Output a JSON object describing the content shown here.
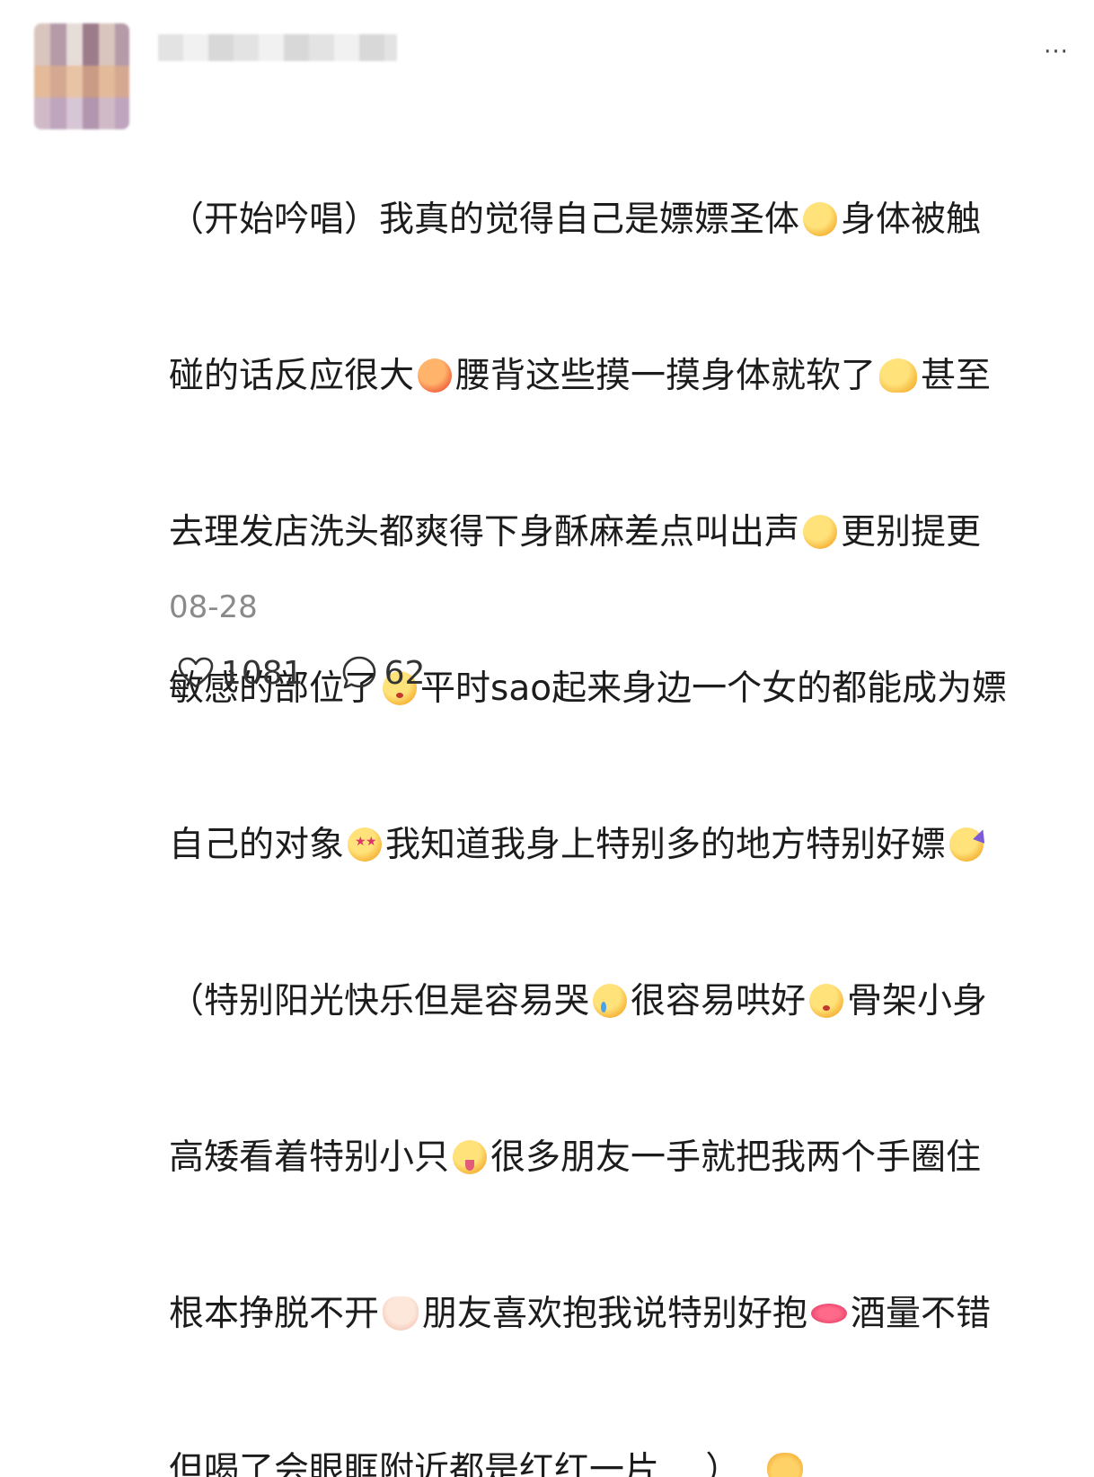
{
  "post": {
    "lines": [
      "（开始吟唱）我真的觉得自己是嫖嫖圣体",
      "身体被触",
      "碰的话反应很大",
      "腰背这些摸一摸身体就软了",
      "甚至",
      "去理发店洗头都爽得下身酥麻差点叫出声",
      "更别提更",
      "敏感的部位了",
      "平时sao起来身边一个女的都能成为嫖",
      "自己的对象",
      "我知道我身上特别多的地方特别好嫖",
      "（特别阳光快乐但是容易哭",
      "很容易哄好",
      "骨架小身",
      "高矮看着特别小只",
      "很多朋友一手就把我两个手圈住",
      "根本挣脱不开",
      "朋友喜欢抱我说特别好抱",
      "酒量不错",
      "但喝了会眼眶附近都是红红一片….）"
    ],
    "emojis": [
      "pleading-face",
      "hot-face",
      "melting-face",
      "shushing-face",
      "kissing-face",
      "star-struck",
      "partying-face",
      "crying-face",
      "kissing-closed-eyes",
      "zany-tongue-face",
      "open-hands",
      "lips",
      "heart-eyes-cat"
    ],
    "timestamp": "08-28"
  },
  "actions": {
    "likes": "1081",
    "comments": "62"
  },
  "menu": {
    "more_label": "···"
  },
  "colors": {
    "text": "#1c1c1c",
    "muted": "#8a8a8a",
    "background": "#ffffff"
  }
}
